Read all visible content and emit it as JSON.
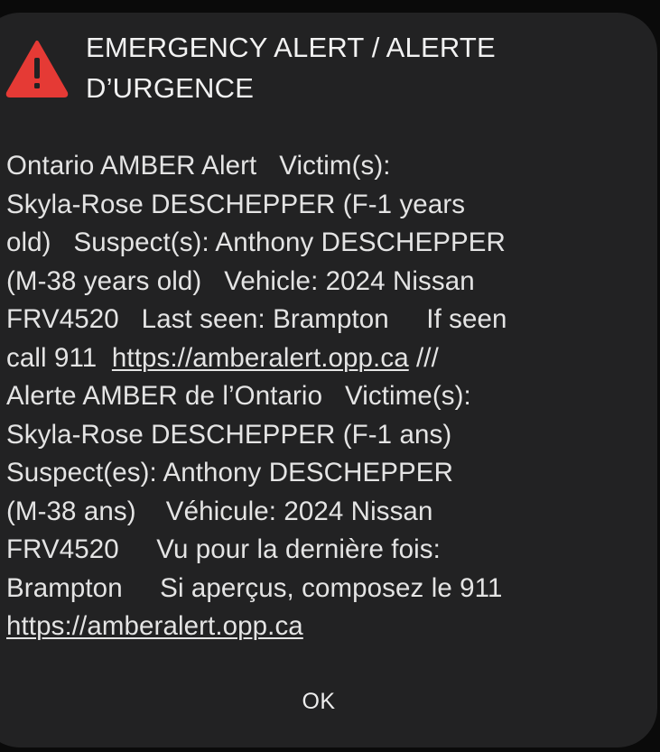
{
  "alert": {
    "title_line1": "EMERGENCY ALERT / ALERTE",
    "title_line2": "D’URGENCE",
    "icon": "warning-triangle-icon",
    "colors": {
      "dialog_background": "#222223",
      "icon_red": "#e53a35",
      "text": "#e4e4e4"
    }
  },
  "message": {
    "line1": "Ontario AMBER Alert   Victim(s):",
    "line2": "Skyla-Rose DESCHEPPER (F-1 years",
    "line3": "old)   Suspect(s): Anthony DESCHEPPER",
    "line4": "(M-38 years old)   Vehicle: 2024 Nissan",
    "line5": "FRV4520   Last seen: Brampton     If seen",
    "line6_prefix": "call 911  ",
    "link1": "https://amberalert.opp.ca",
    "line6_suffix": " ///",
    "line7": "Alerte AMBER de l’Ontario   Victime(s):",
    "line8": "Skyla-Rose DESCHEPPER (F-1 ans)",
    "line9": "Suspect(es): Anthony DESCHEPPER",
    "line10": "(M-38 ans)    Véhicule: 2024 Nissan",
    "line11": "FRV4520     Vu pour la dernière fois:",
    "line12": "Brampton     Si aperçus, composez le 911",
    "link2": "https://amberalert.opp.ca"
  },
  "actions": {
    "ok_label": "OK"
  }
}
